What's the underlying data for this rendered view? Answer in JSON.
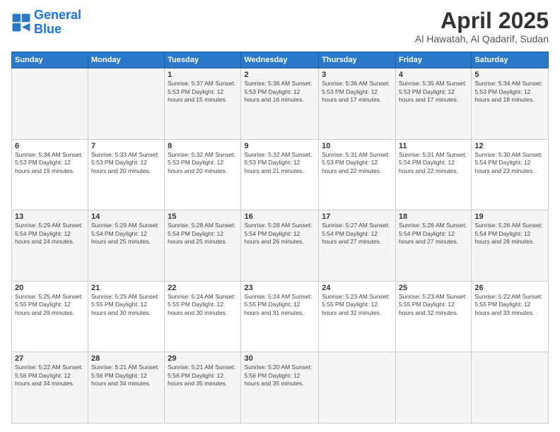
{
  "header": {
    "logo_line1": "General",
    "logo_line2": "Blue",
    "title": "April 2025",
    "subtitle": "Al Hawatah, Al Qadarif, Sudan"
  },
  "calendar": {
    "days_of_week": [
      "Sunday",
      "Monday",
      "Tuesday",
      "Wednesday",
      "Thursday",
      "Friday",
      "Saturday"
    ],
    "weeks": [
      [
        {
          "day": "",
          "info": ""
        },
        {
          "day": "",
          "info": ""
        },
        {
          "day": "1",
          "info": "Sunrise: 5:37 AM\nSunset: 5:53 PM\nDaylight: 12 hours\nand 15 minutes."
        },
        {
          "day": "2",
          "info": "Sunrise: 5:36 AM\nSunset: 5:53 PM\nDaylight: 12 hours\nand 16 minutes."
        },
        {
          "day": "3",
          "info": "Sunrise: 5:36 AM\nSunset: 5:53 PM\nDaylight: 12 hours\nand 17 minutes."
        },
        {
          "day": "4",
          "info": "Sunrise: 5:35 AM\nSunset: 5:53 PM\nDaylight: 12 hours\nand 17 minutes."
        },
        {
          "day": "5",
          "info": "Sunrise: 5:34 AM\nSunset: 5:53 PM\nDaylight: 12 hours\nand 18 minutes."
        }
      ],
      [
        {
          "day": "6",
          "info": "Sunrise: 5:34 AM\nSunset: 5:53 PM\nDaylight: 12 hours\nand 19 minutes."
        },
        {
          "day": "7",
          "info": "Sunrise: 5:33 AM\nSunset: 5:53 PM\nDaylight: 12 hours\nand 20 minutes."
        },
        {
          "day": "8",
          "info": "Sunrise: 5:32 AM\nSunset: 5:53 PM\nDaylight: 12 hours\nand 20 minutes."
        },
        {
          "day": "9",
          "info": "Sunrise: 5:32 AM\nSunset: 5:53 PM\nDaylight: 12 hours\nand 21 minutes."
        },
        {
          "day": "10",
          "info": "Sunrise: 5:31 AM\nSunset: 5:53 PM\nDaylight: 12 hours\nand 22 minutes."
        },
        {
          "day": "11",
          "info": "Sunrise: 5:31 AM\nSunset: 5:54 PM\nDaylight: 12 hours\nand 22 minutes."
        },
        {
          "day": "12",
          "info": "Sunrise: 5:30 AM\nSunset: 5:54 PM\nDaylight: 12 hours\nand 23 minutes."
        }
      ],
      [
        {
          "day": "13",
          "info": "Sunrise: 5:29 AM\nSunset: 5:54 PM\nDaylight: 12 hours\nand 24 minutes."
        },
        {
          "day": "14",
          "info": "Sunrise: 5:29 AM\nSunset: 5:54 PM\nDaylight: 12 hours\nand 25 minutes."
        },
        {
          "day": "15",
          "info": "Sunrise: 5:28 AM\nSunset: 5:54 PM\nDaylight: 12 hours\nand 25 minutes."
        },
        {
          "day": "16",
          "info": "Sunrise: 5:28 AM\nSunset: 5:54 PM\nDaylight: 12 hours\nand 26 minutes."
        },
        {
          "day": "17",
          "info": "Sunrise: 5:27 AM\nSunset: 5:54 PM\nDaylight: 12 hours\nand 27 minutes."
        },
        {
          "day": "18",
          "info": "Sunrise: 5:26 AM\nSunset: 5:54 PM\nDaylight: 12 hours\nand 27 minutes."
        },
        {
          "day": "19",
          "info": "Sunrise: 5:26 AM\nSunset: 5:54 PM\nDaylight: 12 hours\nand 28 minutes."
        }
      ],
      [
        {
          "day": "20",
          "info": "Sunrise: 5:25 AM\nSunset: 5:55 PM\nDaylight: 12 hours\nand 29 minutes."
        },
        {
          "day": "21",
          "info": "Sunrise: 5:25 AM\nSunset: 5:55 PM\nDaylight: 12 hours\nand 30 minutes."
        },
        {
          "day": "22",
          "info": "Sunrise: 5:24 AM\nSunset: 5:55 PM\nDaylight: 12 hours\nand 30 minutes."
        },
        {
          "day": "23",
          "info": "Sunrise: 5:24 AM\nSunset: 5:55 PM\nDaylight: 12 hours\nand 31 minutes."
        },
        {
          "day": "24",
          "info": "Sunrise: 5:23 AM\nSunset: 5:55 PM\nDaylight: 12 hours\nand 32 minutes."
        },
        {
          "day": "25",
          "info": "Sunrise: 5:23 AM\nSunset: 5:55 PM\nDaylight: 12 hours\nand 32 minutes."
        },
        {
          "day": "26",
          "info": "Sunrise: 5:22 AM\nSunset: 5:55 PM\nDaylight: 12 hours\nand 33 minutes."
        }
      ],
      [
        {
          "day": "27",
          "info": "Sunrise: 5:22 AM\nSunset: 5:56 PM\nDaylight: 12 hours\nand 34 minutes."
        },
        {
          "day": "28",
          "info": "Sunrise: 5:21 AM\nSunset: 5:56 PM\nDaylight: 12 hours\nand 34 minutes."
        },
        {
          "day": "29",
          "info": "Sunrise: 5:21 AM\nSunset: 5:56 PM\nDaylight: 12 hours\nand 35 minutes."
        },
        {
          "day": "30",
          "info": "Sunrise: 5:20 AM\nSunset: 5:56 PM\nDaylight: 12 hours\nand 35 minutes."
        },
        {
          "day": "",
          "info": ""
        },
        {
          "day": "",
          "info": ""
        },
        {
          "day": "",
          "info": ""
        }
      ]
    ]
  }
}
